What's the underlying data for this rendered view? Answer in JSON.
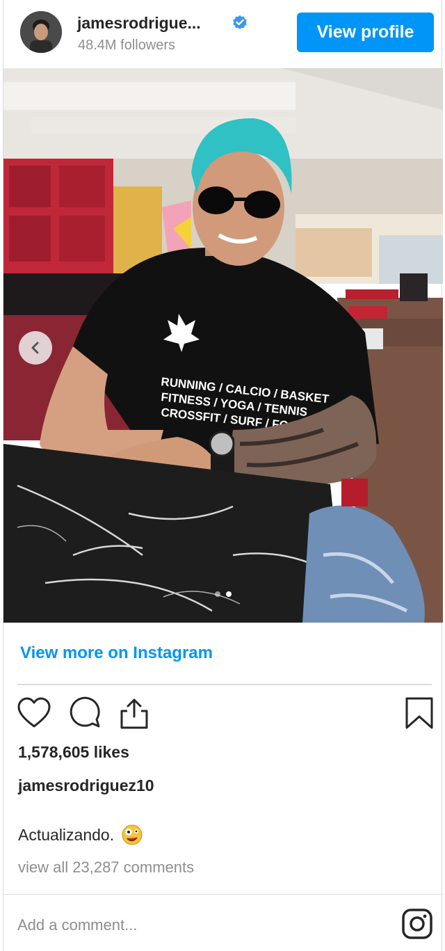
{
  "header": {
    "username": "jamesrodrigue...",
    "followers": "48.4M followers",
    "view_profile_label": "View profile"
  },
  "photo": {
    "shirt_text": "RUNNING / CALCIO / BASKET\nFITNESS / YOGA / TENNIS\nCROSSFIT / SURF / FOOTBALL"
  },
  "view_more_label": "View more on Instagram",
  "post": {
    "likes": "1,578,605 likes",
    "owner": "jamesrodriguez10",
    "caption": "Actualizando.",
    "view_comments": "view all 23,287 comments"
  },
  "comment_box": {
    "placeholder": "Add a comment..."
  },
  "colors": {
    "accent_blue": "#0095f6",
    "text": "#262626",
    "muted": "#8e8e8e",
    "divider": "#dbdbdb"
  },
  "icons": [
    "verified-badge-icon",
    "chevron-left-icon",
    "heart-icon",
    "comment-icon",
    "share-icon",
    "bookmark-icon",
    "instagram-icon",
    "emoji-icon"
  ]
}
